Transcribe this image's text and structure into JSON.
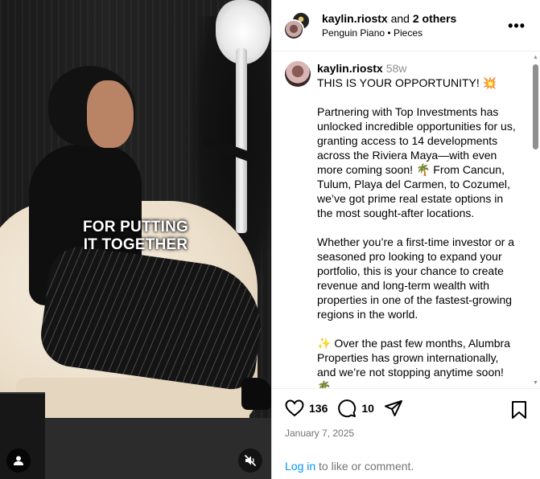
{
  "video": {
    "caption_line1": "FOR PUTTING",
    "caption_line2": "IT TOGETHER"
  },
  "header": {
    "username": "kaylin.riostx",
    "joiner": "and",
    "others": "2 others",
    "audio": "Penguin Piano",
    "separator": "•",
    "audio_detail": "Pieces",
    "more": "•••"
  },
  "caption": {
    "username": "kaylin.riostx",
    "time": "58w",
    "text": "THIS IS YOUR OPPORTUNITY! 💥\n\nPartnering with Top Investments has unlocked incredible opportunities for us, granting access to 14 developments across the Riviera Maya—with even more coming soon! 🌴 From Cancun, Tulum, Playa del Carmen, to Cozumel, we’ve got prime real estate options in the most sought-after locations.\n\nWhether you’re a first-time investor or a seasoned pro looking to expand your portfolio, this is your chance to create revenue and long-term wealth with properties in one of the fastest-growing regions in the world.\n\n✨ Over the past few months, Alumbra Properties has grown internationally, and we’re not stopping anytime soon! 🌴"
  },
  "actions": {
    "likes": "136",
    "comments": "10"
  },
  "date": "January 7, 2025",
  "login": {
    "link": "Log in",
    "rest": " to like or comment."
  }
}
